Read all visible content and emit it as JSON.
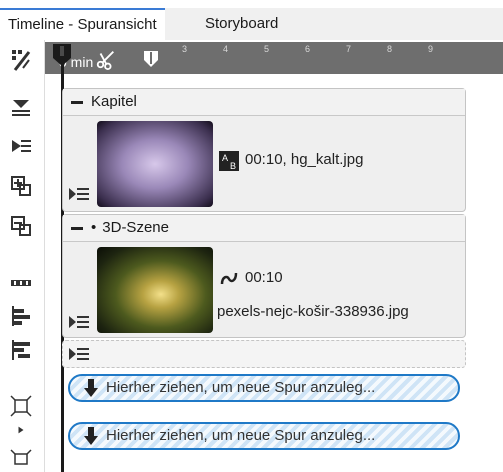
{
  "tabs": [
    {
      "label": "Timeline - Spuransicht",
      "active": true
    },
    {
      "label": "Storyboard",
      "active": false
    }
  ],
  "ruler": {
    "start_label": "0 min",
    "tick_labels": [
      "3",
      "4",
      "5",
      "6",
      "7",
      "8",
      "9"
    ]
  },
  "tracks": [
    {
      "header": "Kapitel",
      "clip": {
        "info": "00:10, hg_kalt.jpg"
      }
    },
    {
      "header": "3D-Szene",
      "clip": {
        "duration": "00:10",
        "filename": "pexels-nejc-košir-338936.jpg"
      }
    }
  ],
  "dropzones": [
    {
      "label": "Hierher ziehen, um neue Spur anzuleg..."
    },
    {
      "label": "Hierher ziehen, um neue Spur anzuleg..."
    }
  ],
  "colors": {
    "accent": "#3a7bd5",
    "ruler_bg": "#6e6e6e",
    "dropzone_border": "#1f79c7",
    "track_bg": "#efefef"
  },
  "icons": {
    "toolbar": [
      "magic-wand-icon",
      "align-center-icon",
      "align-list-icon",
      "add-track-icon",
      "remove-track-icon",
      "timeline-layout-icon",
      "align-left-icon",
      "align-right-icon",
      "fit-icon",
      "distribute-icon"
    ]
  }
}
